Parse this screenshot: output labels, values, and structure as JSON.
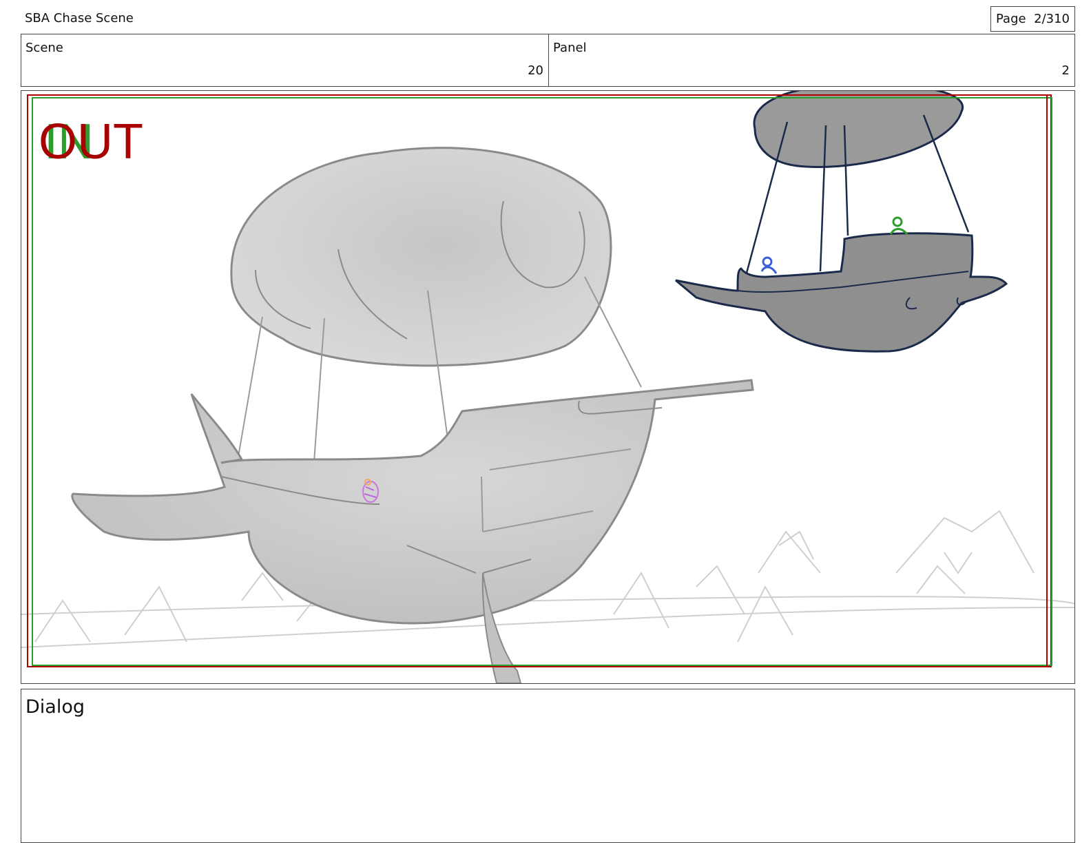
{
  "header": {
    "doc_title": "SBA Chase Scene",
    "page_label": "Page",
    "page_value": "2/310"
  },
  "info": {
    "scene_label": "Scene",
    "scene_value": "20",
    "panel_label": "Panel",
    "panel_value": "2"
  },
  "frame": {
    "in_label": "IN",
    "out_label": "OUT",
    "colors": {
      "safe_area": "#b00000",
      "in_guide": "#2a9d2a",
      "ship": "#c9c9c9",
      "enemy_ship": "#8f8f8f",
      "enemy_outline": "#1b2a4a"
    }
  },
  "dialog": {
    "label": "Dialog",
    "text": ""
  }
}
